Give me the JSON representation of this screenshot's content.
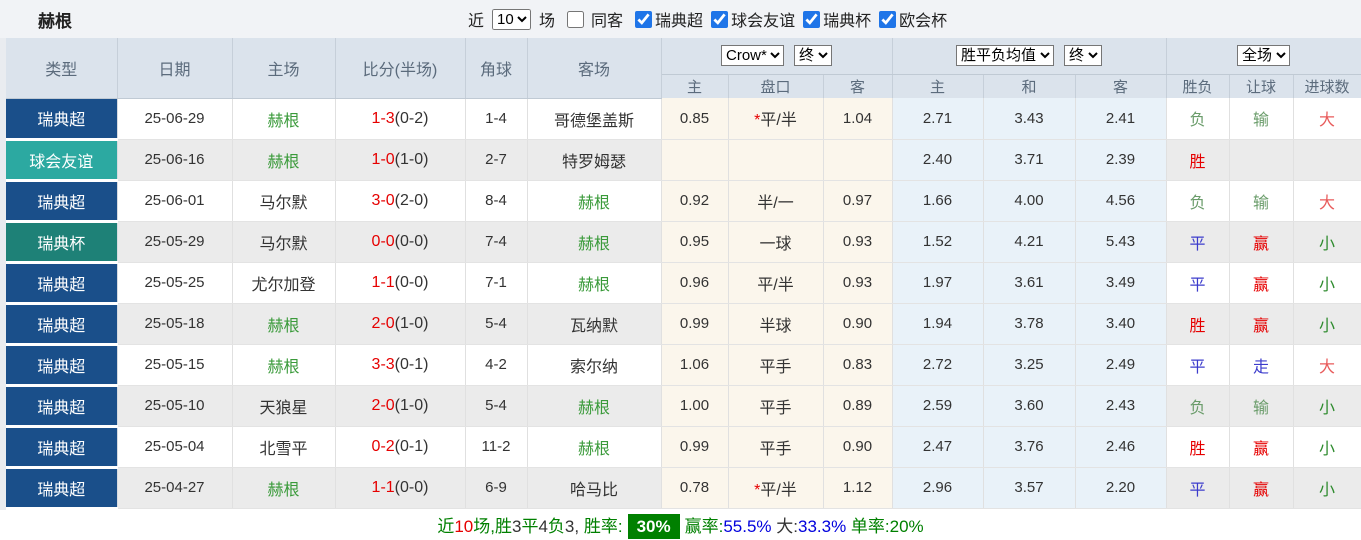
{
  "header": {
    "title": "赫根",
    "recent_label": "近",
    "recent_count": "10",
    "matches_label": "场",
    "same_away_label": "同客",
    "filters": [
      "瑞典超",
      "球会友谊",
      "瑞典杯",
      "欧会杯"
    ]
  },
  "table": {
    "columns": {
      "type": "类型",
      "date": "日期",
      "home": "主场",
      "score": "比分(半场)",
      "corner": "角球",
      "away": "客场"
    },
    "selects": {
      "bookmaker": "Crow*",
      "bookmaker_state": "终",
      "europe": "胜平负均值",
      "europe_state": "终",
      "scope": "全场"
    },
    "sub_columns": {
      "ah_home": "主",
      "ah_line": "盘口",
      "ah_away": "客",
      "eu_home": "主",
      "eu_draw": "和",
      "eu_away": "客",
      "wdl": "胜负",
      "handicap_result": "让球",
      "goals": "进球数"
    },
    "rows": [
      {
        "type": "瑞典超",
        "type_class": "league",
        "date": "25-06-29",
        "home": "赫根",
        "home_class": "team",
        "score": "1-3",
        "half": "(0-2)",
        "corner": "1-4",
        "away": "哥德堡盖斯",
        "away_class": "",
        "ah_star": "*",
        "ah_home": "0.85",
        "ah_line": "平/半",
        "ah_away": "1.04",
        "eu_home": "2.71",
        "eu_draw": "3.43",
        "eu_away": "2.41",
        "wdl": "负",
        "wdl_class": "lose",
        "ah_res": "输",
        "ah_res_class": "lose",
        "goal": "大",
        "goal_class": "big"
      },
      {
        "type": "球会友谊",
        "type_class": "friendly",
        "date": "25-06-16",
        "home": "赫根",
        "home_class": "team",
        "score": "1-0",
        "half": "(1-0)",
        "corner": "2-7",
        "away": "特罗姆瑟",
        "away_class": "",
        "ah_star": "",
        "ah_home": "",
        "ah_line": "",
        "ah_away": "",
        "eu_home": "2.40",
        "eu_draw": "3.71",
        "eu_away": "2.39",
        "wdl": "胜",
        "wdl_class": "win",
        "ah_res": "",
        "ah_res_class": "",
        "goal": "",
        "goal_class": ""
      },
      {
        "type": "瑞典超",
        "type_class": "league",
        "date": "25-06-01",
        "home": "马尔默",
        "home_class": "",
        "score": "3-0",
        "half": "(2-0)",
        "corner": "8-4",
        "away": "赫根",
        "away_class": "team",
        "ah_star": "",
        "ah_home": "0.92",
        "ah_line": "半/一",
        "ah_away": "0.97",
        "eu_home": "1.66",
        "eu_draw": "4.00",
        "eu_away": "4.56",
        "wdl": "负",
        "wdl_class": "lose",
        "ah_res": "输",
        "ah_res_class": "lose",
        "goal": "大",
        "goal_class": "big"
      },
      {
        "type": "瑞典杯",
        "type_class": "cup",
        "date": "25-05-29",
        "home": "马尔默",
        "home_class": "",
        "score": "0-0",
        "half": "(0-0)",
        "corner": "7-4",
        "away": "赫根",
        "away_class": "team",
        "ah_star": "",
        "ah_home": "0.95",
        "ah_line": "一球",
        "ah_away": "0.93",
        "eu_home": "1.52",
        "eu_draw": "4.21",
        "eu_away": "5.43",
        "wdl": "平",
        "wdl_class": "draw",
        "ah_res": "赢",
        "ah_res_class": "win",
        "goal": "小",
        "goal_class": "small"
      },
      {
        "type": "瑞典超",
        "type_class": "league",
        "date": "25-05-25",
        "home": "尤尔加登",
        "home_class": "",
        "score": "1-1",
        "half": "(0-0)",
        "corner": "7-1",
        "away": "赫根",
        "away_class": "team",
        "ah_star": "",
        "ah_home": "0.96",
        "ah_line": "平/半",
        "ah_away": "0.93",
        "eu_home": "1.97",
        "eu_draw": "3.61",
        "eu_away": "3.49",
        "wdl": "平",
        "wdl_class": "draw",
        "ah_res": "赢",
        "ah_res_class": "win",
        "goal": "小",
        "goal_class": "small"
      },
      {
        "type": "瑞典超",
        "type_class": "league",
        "date": "25-05-18",
        "home": "赫根",
        "home_class": "team",
        "score": "2-0",
        "half": "(1-0)",
        "corner": "5-4",
        "away": "瓦纳默",
        "away_class": "",
        "ah_star": "",
        "ah_home": "0.99",
        "ah_line": "半球",
        "ah_away": "0.90",
        "eu_home": "1.94",
        "eu_draw": "3.78",
        "eu_away": "3.40",
        "wdl": "胜",
        "wdl_class": "win",
        "ah_res": "赢",
        "ah_res_class": "win",
        "goal": "小",
        "goal_class": "small"
      },
      {
        "type": "瑞典超",
        "type_class": "league",
        "date": "25-05-15",
        "home": "赫根",
        "home_class": "team",
        "score": "3-3",
        "half": "(0-1)",
        "corner": "4-2",
        "away": "索尔纳",
        "away_class": "",
        "ah_star": "",
        "ah_home": "1.06",
        "ah_line": "平手",
        "ah_away": "0.83",
        "eu_home": "2.72",
        "eu_draw": "3.25",
        "eu_away": "2.49",
        "wdl": "平",
        "wdl_class": "draw",
        "ah_res": "走",
        "ah_res_class": "draw",
        "goal": "大",
        "goal_class": "big"
      },
      {
        "type": "瑞典超",
        "type_class": "league",
        "date": "25-05-10",
        "home": "天狼星",
        "home_class": "",
        "score": "2-0",
        "half": "(1-0)",
        "corner": "5-4",
        "away": "赫根",
        "away_class": "team",
        "ah_star": "",
        "ah_home": "1.00",
        "ah_line": "平手",
        "ah_away": "0.89",
        "eu_home": "2.59",
        "eu_draw": "3.60",
        "eu_away": "2.43",
        "wdl": "负",
        "wdl_class": "lose",
        "ah_res": "输",
        "ah_res_class": "lose",
        "goal": "小",
        "goal_class": "small"
      },
      {
        "type": "瑞典超",
        "type_class": "league",
        "date": "25-05-04",
        "home": "北雪平",
        "home_class": "",
        "score": "0-2",
        "half": "(0-1)",
        "corner": "11-2",
        "away": "赫根",
        "away_class": "team",
        "ah_star": "",
        "ah_home": "0.99",
        "ah_line": "平手",
        "ah_away": "0.90",
        "eu_home": "2.47",
        "eu_draw": "3.76",
        "eu_away": "2.46",
        "wdl": "胜",
        "wdl_class": "win",
        "ah_res": "赢",
        "ah_res_class": "win",
        "goal": "小",
        "goal_class": "small"
      },
      {
        "type": "瑞典超",
        "type_class": "league",
        "date": "25-04-27",
        "home": "赫根",
        "home_class": "team",
        "score": "1-1",
        "half": "(0-0)",
        "corner": "6-9",
        "away": "哈马比",
        "away_class": "",
        "ah_star": "*",
        "ah_home": "0.78",
        "ah_line": "平/半",
        "ah_away": "1.12",
        "eu_home": "2.96",
        "eu_draw": "3.57",
        "eu_away": "2.20",
        "wdl": "平",
        "wdl_class": "draw",
        "ah_res": "赢",
        "ah_res_class": "win",
        "goal": "小",
        "goal_class": "small"
      }
    ]
  },
  "footer": {
    "summary_text": "近10场,胜3平4负3, 胜率: 30% 赢率:55.5% 大:33.3% 单率:20%",
    "win_rate_badge": "30%",
    "segments": [
      {
        "t": "近",
        "c": "g"
      },
      {
        "t": "10",
        "c": "r"
      },
      {
        "t": "场,",
        "c": "g"
      },
      {
        "t": "胜",
        "c": "g"
      },
      {
        "t": "3",
        "c": "d"
      },
      {
        "t": "平",
        "c": "g"
      },
      {
        "t": "4",
        "c": "d"
      },
      {
        "t": "负",
        "c": "g"
      },
      {
        "t": "3",
        "c": "d"
      },
      {
        "t": ", ",
        "c": "d"
      },
      {
        "t": "胜率:",
        "c": "g"
      },
      {
        "t": "30%",
        "c": "badge"
      },
      {
        "t": "赢率:",
        "c": "g"
      },
      {
        "t": "55.5%",
        "c": "b"
      },
      {
        "t": " 大:",
        "c": "d"
      },
      {
        "t": "33.3%",
        "c": "b"
      },
      {
        "t": " 单率:",
        "c": "g"
      },
      {
        "t": "20%",
        "c": "g"
      }
    ]
  },
  "colors": {
    "league_blue": "#1a4f8a",
    "friendly_teal": "#2ca9a1",
    "cup_teal": "#1e8177",
    "team_green": "#3a9a3a",
    "score_red": "#e60000",
    "win_red": "#e60000",
    "draw_blue": "#3c3ccc",
    "lose_green": "#6a9c6a",
    "big_red": "#e85b5b",
    "small_green": "#2e8b2e",
    "ah_col_bg": "#fbf6ec",
    "eu_col_bg": "#e9f2f9",
    "header_bg": "#dbe3ec",
    "badge_green": "#008000",
    "link_blue": "#0000dd",
    "checkbox_blue": "#1f75e8"
  }
}
